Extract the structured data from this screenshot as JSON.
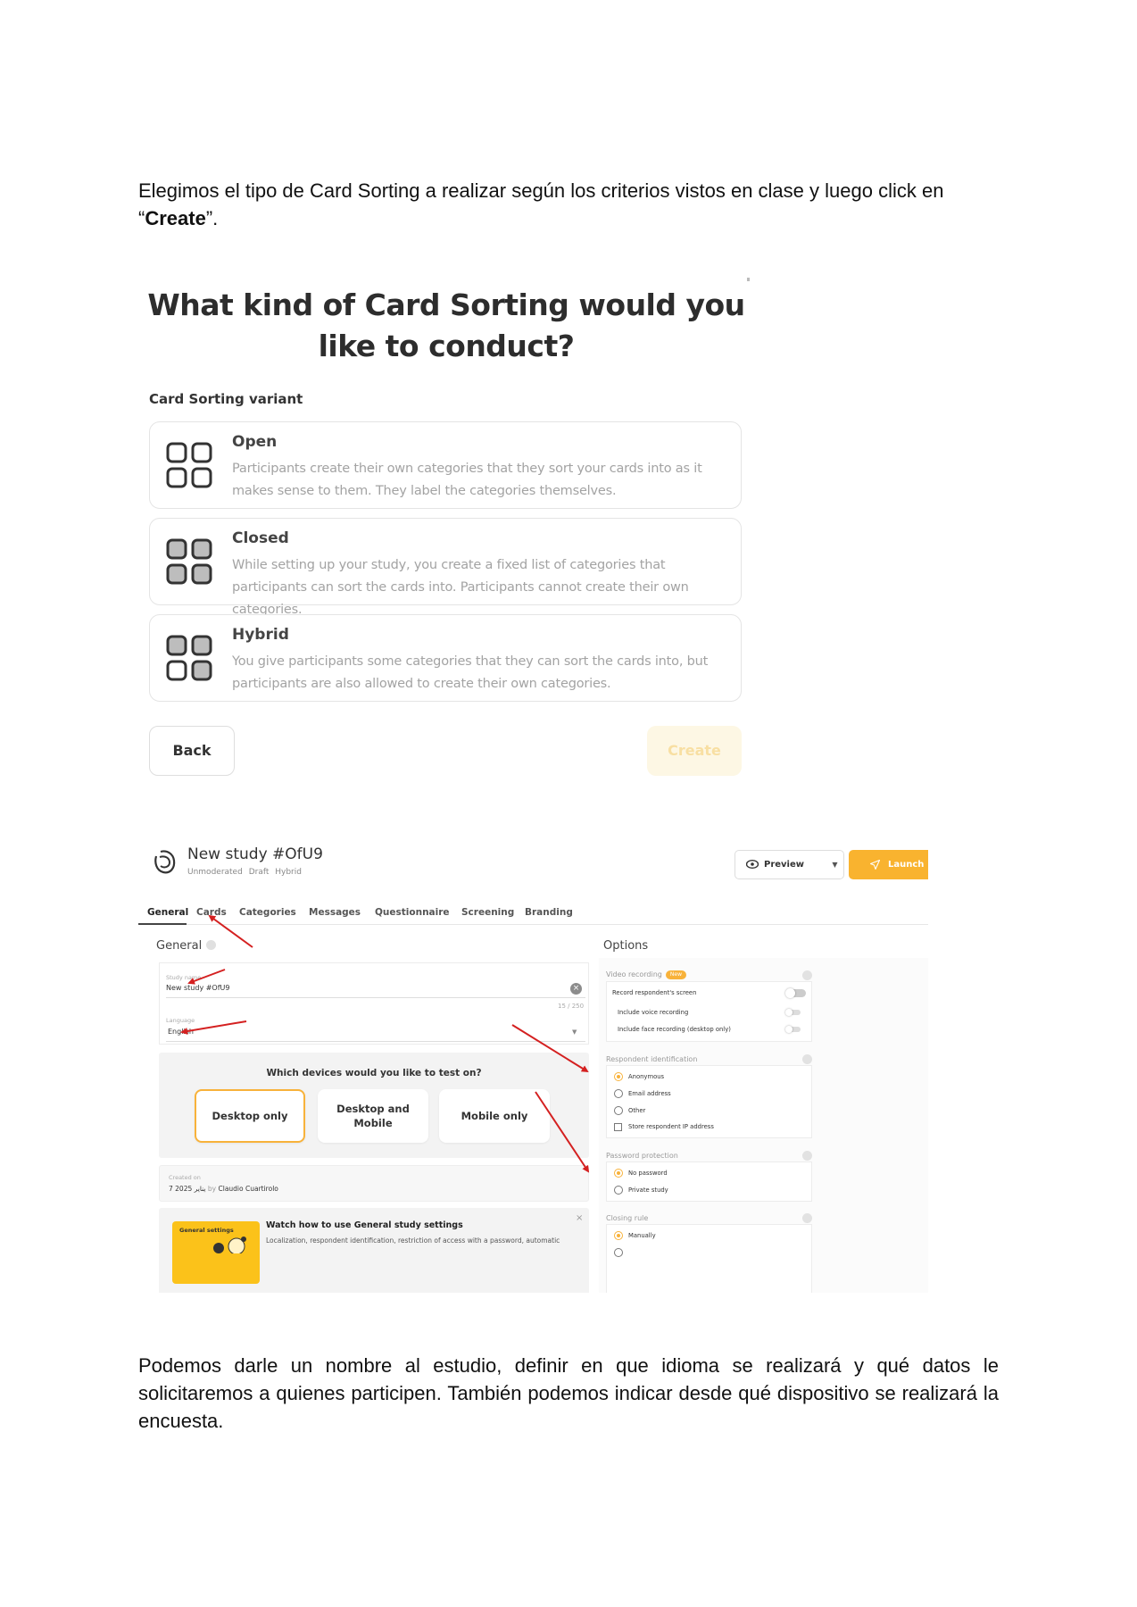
{
  "intro": {
    "text_before": "Elegimos el tipo de Card Sorting a realizar según los criterios vistos en clase y luego click en “",
    "bold": "Create",
    "text_after": "”."
  },
  "variant_screen": {
    "heading_line1": "What kind of Card Sorting would you",
    "heading_line2": "like to conduct?",
    "section_label": "Card Sorting variant",
    "variants": [
      {
        "title": "Open",
        "description": "Participants create their own categories that they sort your cards into as it makes sense to them. They label the categories themselves.",
        "icon": "grid-outline-icon"
      },
      {
        "title": "Closed",
        "description": "While setting up your study, you create a fixed list of categories that participants can sort the cards into. Participants cannot create their own categories.",
        "icon": "grid-filled-icon"
      },
      {
        "title": "Hybrid",
        "description": "You give participants some categories that they can sort the cards into, but participants are also allowed to create their own categories.",
        "icon": "grid-mixed-icon"
      }
    ],
    "back_label": "Back",
    "create_label": "Create",
    "colors": {
      "create_bg": "#fdf7e4",
      "create_text": "#f8dfa2"
    }
  },
  "study_screen": {
    "title": "New study #OfU9",
    "meta": [
      "Unmoderated",
      "Draft",
      "Hybrid"
    ],
    "preview_label": "Preview",
    "launch_label": "Launch",
    "tabs": [
      "General",
      "Cards",
      "Categories",
      "Messages",
      "Questionnaire",
      "Screening",
      "Branding"
    ],
    "active_tab": "General",
    "general_heading": "General",
    "study_name_label": "Study name",
    "study_name_value": "New study #OfU9",
    "study_name_counter": "15 / 250",
    "language_label": "Language",
    "language_value": "English",
    "devices_question": "Which devices would you like to test on?",
    "devices": [
      "Desktop only",
      "Desktop and Mobile",
      "Mobile only"
    ],
    "device_selected": "Desktop only",
    "created_label": "Created on",
    "created_date": "7 2025 يناير",
    "created_by_word": "by",
    "created_author": "Claudio Cuartirolo",
    "video_thumb_label": "General settings",
    "video_title": "Watch how to use General study settings",
    "video_desc": "Localization, respondent identification, restriction of access with a password, automatic",
    "video_close": "×",
    "options_heading": "Options",
    "video_recording_label": "Video recording",
    "new_badge": "New",
    "record_screen": "Record respondent's screen",
    "voice_recording": "Include voice recording",
    "face_recording": "Include face recording (desktop only)",
    "respondent_id_label": "Respondent identification",
    "respondent_options": [
      "Anonymous",
      "Email address",
      "Other"
    ],
    "respondent_selected": "Anonymous",
    "store_ip": "Store respondent IP address",
    "password_label": "Password protection",
    "password_options": [
      "No password",
      "Private study"
    ],
    "password_selected": "No password",
    "closing_label": "Closing rule",
    "closing_option": "Manually",
    "colors": {
      "accent": "#f9b32f",
      "arrow": "#d42020"
    }
  },
  "outro": {
    "text": "Podemos darle un nombre al estudio, definir en que idioma se realizará y qué datos le solicitaremos a quienes participen. También podemos indicar desde qué dispositivo se realizará la encuesta."
  }
}
